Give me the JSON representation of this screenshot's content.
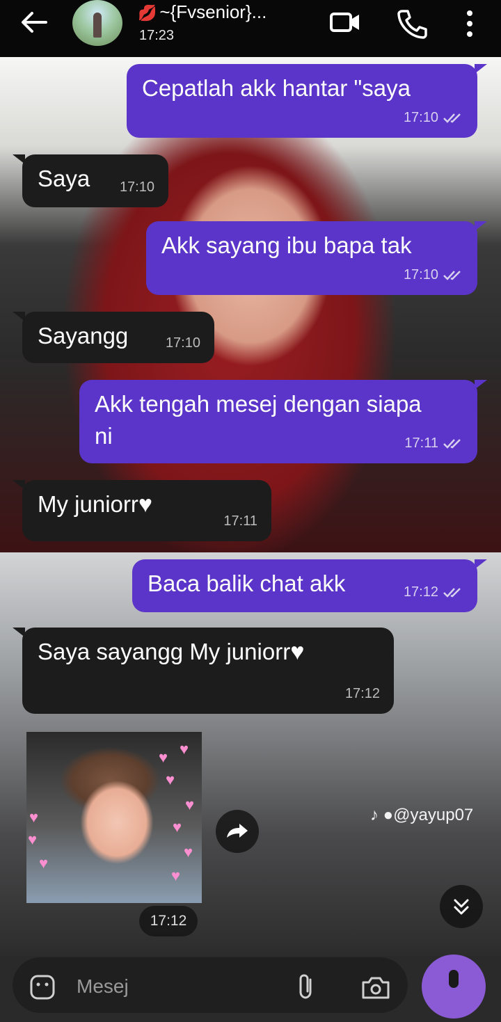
{
  "header": {
    "contact_name": "~{Fvsenior}...",
    "status_time": "17:23",
    "icons": [
      "back-arrow-icon",
      "lips-icon",
      "video-camera-icon",
      "phone-icon",
      "more-vertical-icon"
    ]
  },
  "messages": [
    {
      "direction": "out",
      "text": "Cepatlah akk hantar \"saya",
      "time": "17:10",
      "status": "read"
    },
    {
      "direction": "in",
      "text": "Saya",
      "time": "17:10"
    },
    {
      "direction": "out",
      "text": "Akk sayang ibu bapa tak",
      "time": "17:10",
      "status": "read"
    },
    {
      "direction": "in",
      "text": "Sayangg",
      "time": "17:10"
    },
    {
      "direction": "out",
      "text": "Akk tengah mesej dengan siapa ni",
      "time": "17:11",
      "status": "read"
    },
    {
      "direction": "in",
      "text": "My juniorr",
      "time": "17:11",
      "emoji": "white-heart"
    },
    {
      "direction": "out",
      "text": "Baca balik chat akk",
      "time": "17:12",
      "status": "read"
    },
    {
      "direction": "in",
      "text": "Saya sayangg My juniorr",
      "time": "17:12",
      "emoji": "white-heart"
    }
  ],
  "sticker": {
    "time": "17:12"
  },
  "watermark": "@yayup07",
  "composer": {
    "placeholder": "Mesej"
  },
  "colors": {
    "outgoing_bubble": "#5b35c9",
    "incoming_bubble": "#1c1c1c",
    "header_bg": "#080808",
    "mic_button": "#8b5bd6"
  }
}
